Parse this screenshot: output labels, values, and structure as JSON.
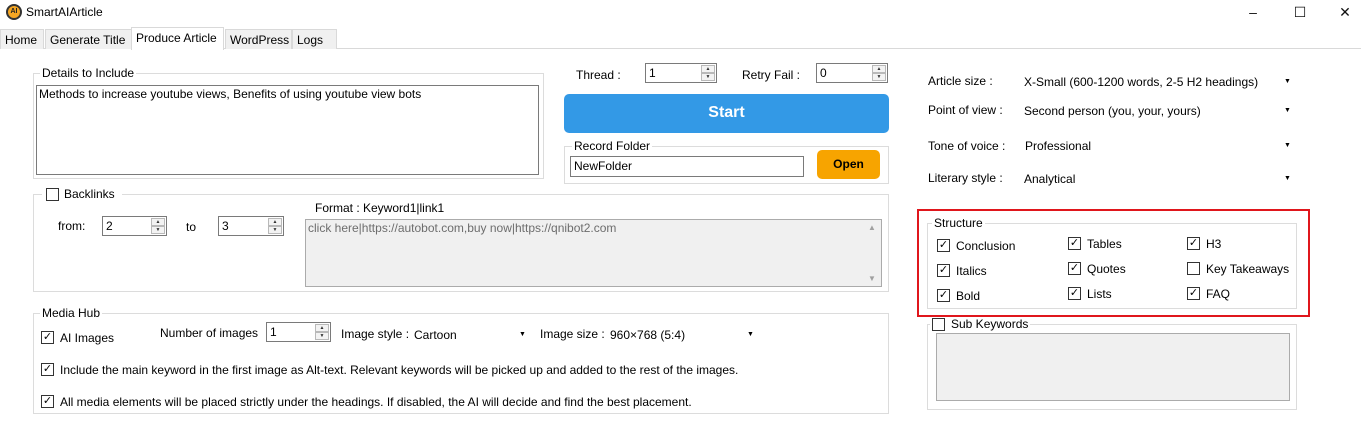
{
  "app": {
    "title": "SmartAIArticle",
    "icon_text": "AI",
    "minimize": "–",
    "maximize": "☐",
    "close": "✕"
  },
  "tabs": [
    {
      "label": "Home",
      "active": false
    },
    {
      "label": "Generate Title",
      "active": false
    },
    {
      "label": "Produce Article",
      "active": true
    },
    {
      "label": "WordPress",
      "active": false
    },
    {
      "label": "Logs",
      "active": false
    }
  ],
  "details": {
    "legend": "Details to Include",
    "value": "Methods to increase youtube views, Benefits of using youtube view bots"
  },
  "thread": {
    "label": "Thread :",
    "value": "1"
  },
  "retry": {
    "label": "Retry Fail :",
    "value": "0"
  },
  "start_label": "Start",
  "record": {
    "legend": "Record Folder",
    "value": "NewFolder",
    "open_label": "Open"
  },
  "backlinks": {
    "legend": "Backlinks",
    "checked": false,
    "from_label": "from:",
    "from_value": "2",
    "to_label": "to",
    "to_value": "3",
    "format_label": "Format : Keyword1|link1",
    "links_value": "click here|https://autobot.com,buy now|https://qnibot2.com"
  },
  "media": {
    "legend": "Media Hub",
    "ai_images_label": "AI Images",
    "ai_images_checked": true,
    "num_images_label": "Number of images",
    "num_images_value": "1",
    "image_style_label": "Image style :",
    "image_style_value": "Cartoon",
    "image_size_label": "Image size :",
    "image_size_value": "960×768 (5:4)",
    "alt_text_label": "Include the main keyword in the first image as Alt-text. Relevant keywords will be picked up and added to the rest of the images.",
    "alt_text_checked": true,
    "placement_label": "All media elements will be placed strictly under the headings. If disabled, the AI will decide and find the best placement.",
    "placement_checked": true
  },
  "settings": {
    "article_size_label": "Article size :",
    "article_size_value": "X-Small (600-1200 words, 2-5 H2 headings)",
    "point_of_view_label": "Point of view :",
    "point_of_view_value": "Second person (you, your, yours)",
    "tone_label": "Tone of voice :",
    "tone_value": "Professional",
    "literary_label": "Literary style :",
    "literary_value": "Analytical"
  },
  "structure": {
    "legend": "Structure",
    "items": [
      {
        "label": "Conclusion",
        "checked": true
      },
      {
        "label": "Tables",
        "checked": true
      },
      {
        "label": "H3",
        "checked": true
      },
      {
        "label": "Italics",
        "checked": true
      },
      {
        "label": "Quotes",
        "checked": true
      },
      {
        "label": "Key Takeaways",
        "checked": false
      },
      {
        "label": "Bold",
        "checked": true
      },
      {
        "label": "Lists",
        "checked": true
      },
      {
        "label": "FAQ",
        "checked": true
      }
    ]
  },
  "sub_keywords": {
    "legend": "Sub Keywords",
    "checked": false,
    "value": ""
  },
  "glyphs": {
    "check": "✓",
    "up": "▲",
    "down": "▼",
    "dd": "▼"
  },
  "colors": {
    "start": "#3399e6",
    "open": "#f7a400",
    "highlight": "#e0161c"
  }
}
